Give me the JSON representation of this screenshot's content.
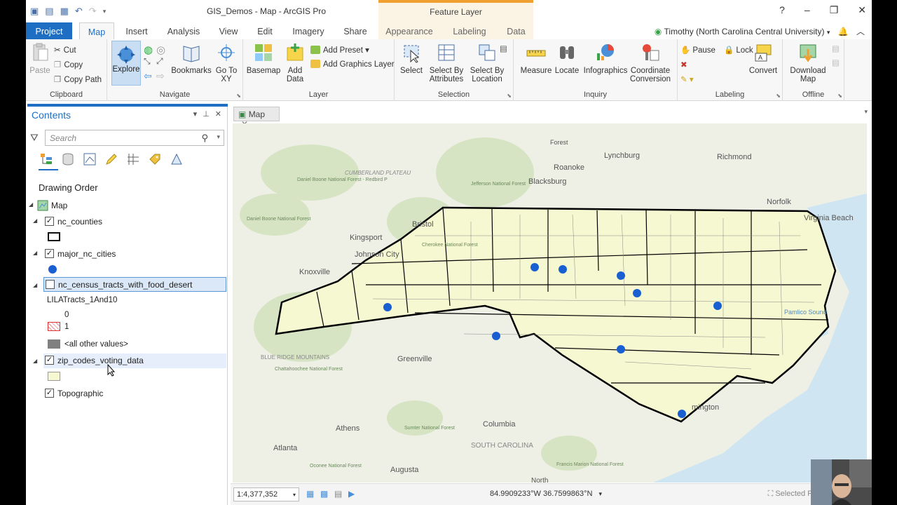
{
  "app": {
    "title": "GIS_Demos - Map - ArcGIS Pro",
    "context_tab_header": "Feature Layer",
    "help": "?",
    "user": "Timothy (North Carolina Central University)"
  },
  "tabs": [
    "Project",
    "Map",
    "Insert",
    "Analysis",
    "View",
    "Edit",
    "Imagery",
    "Share",
    "Appearance",
    "Labeling",
    "Data"
  ],
  "ribbon": {
    "clipboard": {
      "label": "Clipboard",
      "paste": "Paste",
      "cut": "Cut",
      "copy": "Copy",
      "copy_path": "Copy Path"
    },
    "navigate": {
      "label": "Navigate",
      "explore": "Explore",
      "bookmarks": "Bookmarks",
      "go_to_xy": "Go To XY"
    },
    "layer": {
      "label": "Layer",
      "basemap": "Basemap",
      "add_data": "Add Data",
      "add_preset": "Add Preset",
      "add_graphics_layer": "Add Graphics Layer"
    },
    "selection": {
      "label": "Selection",
      "select": "Select",
      "select_by_attributes": "Select By Attributes",
      "select_by_location": "Select By Location"
    },
    "inquiry": {
      "label": "Inquiry",
      "measure": "Measure",
      "locate": "Locate",
      "infographics": "Infographics",
      "coordinate_conversion": "Coordinate Conversion"
    },
    "labeling": {
      "label": "Labeling",
      "pause": "Pause",
      "lock": "Lock",
      "convert": "Convert"
    },
    "offline": {
      "label": "Offline",
      "download_map": "Download Map"
    }
  },
  "contents": {
    "title": "Contents",
    "search_placeholder": "Search",
    "drawing_order": "Drawing Order",
    "map_label": "Map",
    "layers": [
      {
        "name": "nc_counties",
        "checked": true
      },
      {
        "name": "major_nc_cities",
        "checked": true
      },
      {
        "name": "nc_census_tracts_with_food_desert",
        "checked": false
      },
      {
        "name": "zip_codes_voting_data",
        "checked": true
      },
      {
        "name": "Topographic",
        "checked": true
      }
    ],
    "legend": {
      "field": "LILATracts_1And10",
      "v0": "0",
      "v1": "1",
      "other": "<all other values>"
    }
  },
  "map_view": {
    "tab_label": "Map",
    "scale": "1:4,377,352",
    "coordinates": "84.9909233°W 36.7599863°N",
    "selected_features": "Selected Featur",
    "place_labels": [
      "Forest",
      "Lynchburg",
      "Richmond",
      "Roanoke",
      "CUMBERLAND PLATEAU",
      "Daniel Boone National Forest - Redbird P",
      "Jefferson National Forest",
      "Blacksburg",
      "Norfolk",
      "Virginia Beach",
      "Daniel Boone National Forest",
      "Bristol",
      "Kingsport",
      "Johnson City",
      "Cherokee National Forest",
      "Knoxville",
      "Greenville",
      "BLUE RIDGE MOUNTAINS",
      "Chattahoochee National Forest",
      "Athens",
      "Sumter National Forest",
      "Columbia",
      "SOUTH CAROLINA",
      "Atlanta",
      "Augusta",
      "Oconee National Forest",
      "Francis Marion National Forest",
      "North",
      "Pamlico Sound",
      "mington"
    ]
  },
  "colors": {
    "accent": "#1e6fc4",
    "county_fill": "#f5f8d0",
    "city_dot": "#1a5fd1",
    "map_bg": "#e8ece0"
  }
}
